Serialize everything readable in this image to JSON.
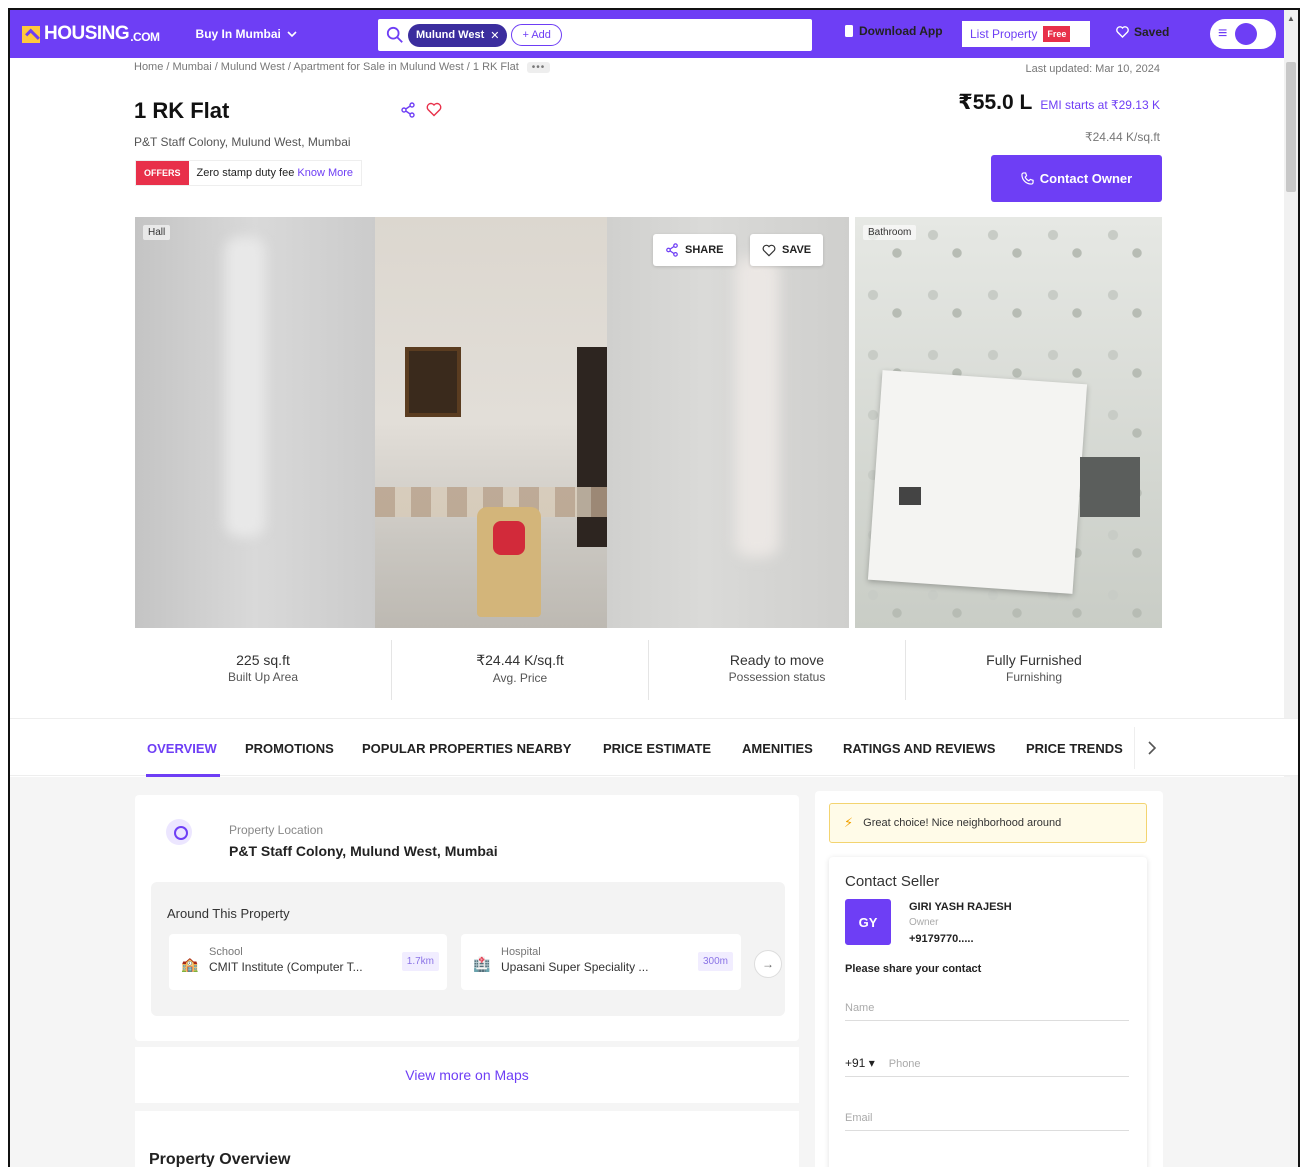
{
  "nav": {
    "logo_text": "HOUSING",
    "logo_suffix": ".COM",
    "buy_label": "Buy In Mumbai",
    "search_chip": "Mulund West",
    "search_add": "+ Add",
    "download_label": "Download App",
    "list_property_label": "List Property",
    "free_badge": "Free",
    "saved_label": "Saved"
  },
  "breadcrumb": {
    "path": "Home / Mumbai / Mulund West / Apartment for Sale in Mulund West / 1 RK Flat",
    "more": "•••"
  },
  "last_updated": "Last updated: Mar 10, 2024",
  "property": {
    "title": "1 RK Flat",
    "address": "P&T Staff Colony, Mulund West, Mumbai",
    "offer_tag": "OFFERS",
    "offer_text": "Zero stamp duty fee",
    "offer_link": "Know More",
    "price": "₹55.0 L",
    "emi": "EMI starts at ₹29.13 K",
    "price_per_sqft": "₹24.44 K/sq.ft",
    "contact_label": "Contact Owner"
  },
  "gallery": {
    "label_hall": "Hall",
    "label_bathroom": "Bathroom",
    "share_label": "SHARE",
    "save_label": "SAVE"
  },
  "stats": [
    {
      "value": "225 sq.ft",
      "label": "Built Up Area"
    },
    {
      "value": "₹24.44 K/sq.ft",
      "label": "Avg. Price"
    },
    {
      "value": "Ready to move",
      "label": "Possession status"
    },
    {
      "value": "Fully Furnished",
      "label": "Furnishing"
    }
  ],
  "tabs": [
    "OVERVIEW",
    "PROMOTIONS",
    "POPULAR PROPERTIES NEARBY",
    "PRICE ESTIMATE",
    "AMENITIES",
    "RATINGS AND REVIEWS",
    "PRICE TRENDS"
  ],
  "location": {
    "label": "Property Location",
    "value": "P&T Staff Colony, Mulund West, Mumbai",
    "around_title": "Around This Property",
    "pois": [
      {
        "category": "School",
        "name": "CMIT Institute (Computer T...",
        "distance": "1.7km"
      },
      {
        "category": "Hospital",
        "name": "Upasani Super Speciality ...",
        "distance": "300m"
      }
    ],
    "maps_link": "View more on Maps"
  },
  "overview_title": "Property Overview",
  "sidebar": {
    "great_choice": "Great choice! Nice neighborhood around",
    "contact_title": "Contact Seller",
    "initials": "GY",
    "seller_name": "GIRI YASH RAJESH",
    "seller_role": "Owner",
    "seller_phone": "+9179770.....",
    "share_prompt": "Please share your contact",
    "name_placeholder": "Name",
    "country_code": "+91",
    "phone_placeholder": "Phone",
    "email_placeholder": "Email"
  },
  "colors": {
    "brand": "#6e3ef5",
    "offer_red": "#e8304a"
  }
}
